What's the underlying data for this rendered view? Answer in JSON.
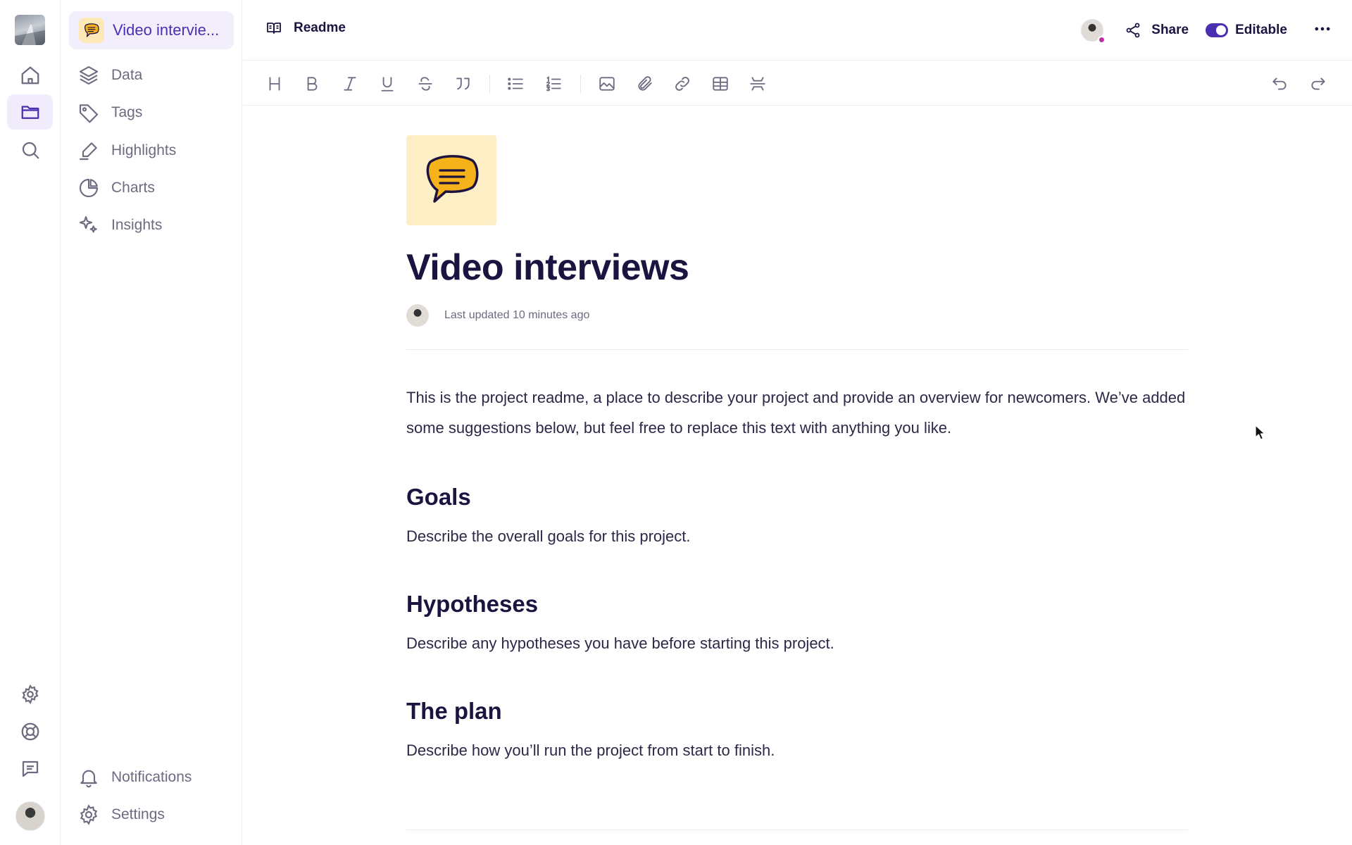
{
  "sidebar": {
    "project_name": "Video intervie...",
    "items": [
      {
        "label": "Data",
        "icon": "layers-icon"
      },
      {
        "label": "Tags",
        "icon": "tag-icon"
      },
      {
        "label": "Highlights",
        "icon": "highlighter-icon"
      },
      {
        "label": "Charts",
        "icon": "pie-chart-icon"
      },
      {
        "label": "Insights",
        "icon": "sparkles-icon"
      }
    ],
    "bottom_items": [
      {
        "label": "Notifications",
        "icon": "bell-icon"
      },
      {
        "label": "Settings",
        "icon": "gear-icon"
      }
    ]
  },
  "rail": {
    "items": [
      "home-icon",
      "folder-icon",
      "search-icon"
    ],
    "bottom_items": [
      "gear-icon",
      "lifebuoy-icon",
      "chat-icon"
    ]
  },
  "topbar": {
    "doc_title": "Readme",
    "share_label": "Share",
    "editable_label": "Editable",
    "editable_on": true
  },
  "toolbar": {
    "buttons": [
      "heading",
      "bold",
      "italic",
      "underline",
      "strikethrough",
      "quote",
      "bullet-list",
      "numbered-list",
      "image",
      "attachment",
      "link",
      "table",
      "divider",
      "undo",
      "redo"
    ]
  },
  "document": {
    "title": "Video interviews",
    "last_updated": "Last updated 10 minutes ago",
    "intro": "This is the project readme, a place to describe your project and provide an overview for newcomers. We’ve added some suggestions below, but feel free to replace this text with anything you like.",
    "sections": [
      {
        "heading": "Goals",
        "body": "Describe the overall goals for this project."
      },
      {
        "heading": "Hypotheses",
        "body": "Describe any hypotheses you have before starting this project."
      },
      {
        "heading": "The plan",
        "body": "Describe how you’ll run the project from start to finish."
      }
    ]
  },
  "colors": {
    "accent": "#4b2fb1",
    "accent_bg": "#f2eefc",
    "text": "#1c1340",
    "muted": "#6e6a80",
    "emoji_bg": "#fdeec6",
    "emoji_fill": "#f6b21b"
  }
}
